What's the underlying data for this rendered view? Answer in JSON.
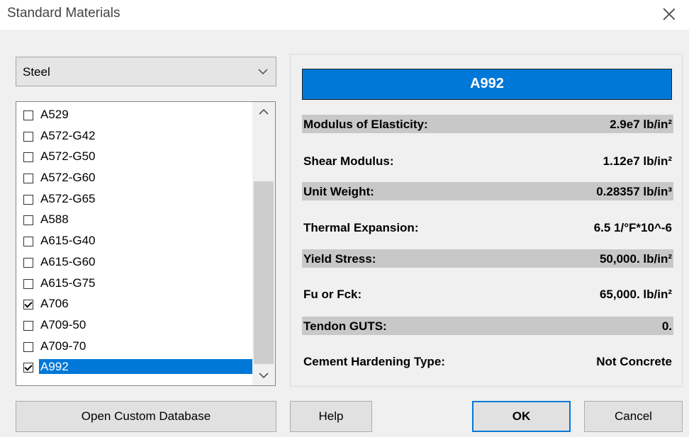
{
  "window": {
    "title": "Standard Materials"
  },
  "material_type": {
    "selected": "Steel"
  },
  "material_list": {
    "items": [
      {
        "label": "A529",
        "checked": false,
        "selected": false
      },
      {
        "label": "A572-G42",
        "checked": false,
        "selected": false
      },
      {
        "label": "A572-G50",
        "checked": false,
        "selected": false
      },
      {
        "label": "A572-G60",
        "checked": false,
        "selected": false
      },
      {
        "label": "A572-G65",
        "checked": false,
        "selected": false
      },
      {
        "label": "A588",
        "checked": false,
        "selected": false
      },
      {
        "label": "A615-G40",
        "checked": false,
        "selected": false
      },
      {
        "label": "A615-G60",
        "checked": false,
        "selected": false
      },
      {
        "label": "A615-G75",
        "checked": false,
        "selected": false
      },
      {
        "label": "A706",
        "checked": true,
        "selected": false
      },
      {
        "label": "A709-50",
        "checked": false,
        "selected": false
      },
      {
        "label": "A709-70",
        "checked": false,
        "selected": false
      },
      {
        "label": "A992",
        "checked": true,
        "selected": true
      }
    ]
  },
  "properties": {
    "header": "A992",
    "header_color": "#0078d7",
    "rows": [
      {
        "name": "Modulus of Elasticity:",
        "value": "2.9e7 lb/in²",
        "shaded": true
      },
      {
        "name": "Shear Modulus:",
        "value": "1.12e7 lb/in²",
        "shaded": false
      },
      {
        "name": "Unit Weight:",
        "value": "0.28357 lb/in³",
        "shaded": true
      },
      {
        "name": "Thermal Expansion:",
        "value": "6.5 1/°F*10^-6",
        "shaded": false
      },
      {
        "name": "Yield Stress:",
        "value": "50,000. lb/in²",
        "shaded": true
      },
      {
        "name": "Fu or Fck:",
        "value": "65,000. lb/in²",
        "shaded": false
      },
      {
        "name": "Tendon GUTS:",
        "value": "0.",
        "shaded": true
      },
      {
        "name": "Cement Hardening Type:",
        "value": "Not Concrete",
        "shaded": false
      }
    ]
  },
  "buttons": {
    "open_custom_database": "Open Custom Database",
    "help": "Help",
    "ok": "OK",
    "cancel": "Cancel"
  }
}
